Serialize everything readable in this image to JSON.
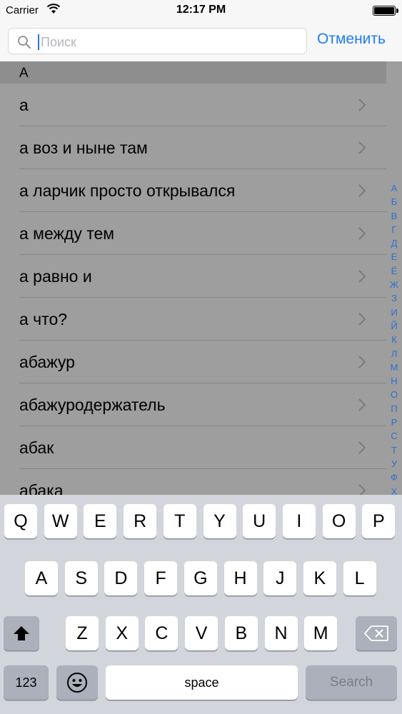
{
  "status_bar": {
    "carrier": "Carrier",
    "time": "12:17 PM"
  },
  "search": {
    "placeholder": "Поиск",
    "cancel_label": "Отменить"
  },
  "section": {
    "header": "А"
  },
  "rows": [
    "а",
    "а воз и ныне там",
    "а ларчик просто открывался",
    "а между тем",
    "а равно и",
    "а что?",
    "абажур",
    "абажуродержатель",
    "абак",
    "абака"
  ],
  "index_letters": [
    "А",
    "Б",
    "В",
    "Г",
    "Д",
    "Е",
    "Ё",
    "Ж",
    "З",
    "И",
    "Й",
    "К",
    "Л",
    "М",
    "Н",
    "О",
    "П",
    "Р",
    "С",
    "Т",
    "У",
    "Ф",
    "Х"
  ],
  "keyboard": {
    "row1": [
      "Q",
      "W",
      "E",
      "R",
      "T",
      "Y",
      "U",
      "I",
      "O",
      "P"
    ],
    "row2": [
      "A",
      "S",
      "D",
      "F",
      "G",
      "H",
      "J",
      "K",
      "L"
    ],
    "row3": [
      "Z",
      "X",
      "C",
      "V",
      "B",
      "N",
      "M"
    ],
    "numbers_label": "123",
    "space_label": "space",
    "search_label": "Search"
  },
  "colors": {
    "accent": "#1f7bf5",
    "dim_overlay": "#9e9e9e",
    "keyboard_bg": "#d2d5db"
  }
}
